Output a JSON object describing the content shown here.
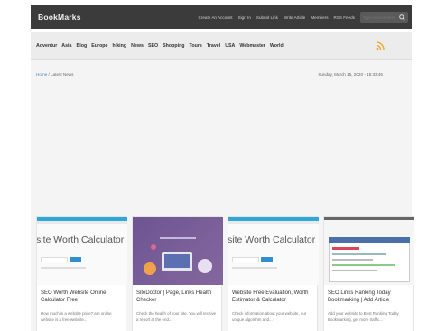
{
  "header": {
    "logo": "BookMarks",
    "nav": [
      "Create An Account",
      "Sign In",
      "Submit Link",
      "Write Article",
      "Members",
      "RSS Feeds"
    ],
    "search": {
      "placeholder": "Type search term"
    }
  },
  "categories": [
    "Adventur",
    "Asia",
    "Blog",
    "Europe",
    "hiking",
    "News",
    "SEO",
    "Shopping",
    "Tours",
    "Travel",
    "USA",
    "Webmaster",
    "World"
  ],
  "breadcrumb": {
    "home": "Home",
    "current": "Latest News"
  },
  "datetime": "Sunday, March 15, 2020 - 15:33:45",
  "cards": [
    {
      "thumb_text": "site Worth Calculator",
      "title": "SEO Worth Website Online Calculator Free",
      "desc": "How much is a website price? are online website is a free website..."
    },
    {
      "thumb_text": "",
      "title": "SiteDoctor | Page, Links Health Checker",
      "desc": "Check the health of your site. You will receive a report at the end..."
    },
    {
      "thumb_text": "site Worth Calculator",
      "title": "Website Free Evaluation, Worth Estimator & Calculator",
      "desc": "Check information about your website, our unique algorithm and..."
    },
    {
      "thumb_text": "",
      "title": "SEO Links Ranking Today Bookmarking | Add Article",
      "desc": "Add your website to Best Ranking Today Bookmarking, get more traffic..."
    }
  ],
  "colors": {
    "topbar": "#3b3b3b",
    "accent": "#2fa8d8",
    "rss": "#f0a020"
  }
}
